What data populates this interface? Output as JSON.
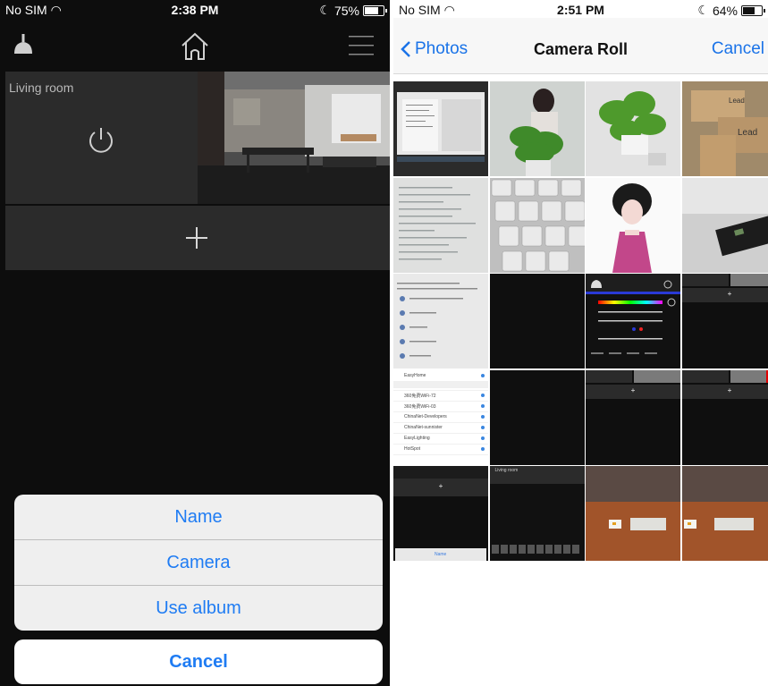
{
  "left_phone": {
    "status": {
      "carrier": "No SIM",
      "time": "2:38 PM",
      "battery": "75%",
      "battery_level": 0.75
    },
    "icons": {
      "lamp": "lamp-icon",
      "home": "home-icon",
      "menu": "menu-icon",
      "power": "power-icon",
      "add": "plus-icon"
    },
    "room": {
      "name": "Living room"
    },
    "action_sheet": {
      "options": [
        "Name",
        "Camera",
        "Use album"
      ],
      "cancel": "Cancel"
    },
    "colors": {
      "accent": "#1f7cf3",
      "tile": "#2b2b2b",
      "background": "#0d0d0d"
    }
  },
  "right_phone": {
    "status": {
      "carrier": "No SIM",
      "time": "2:51 PM",
      "battery": "64%",
      "battery_level": 0.64
    },
    "nav": {
      "back_label": "Photos",
      "title": "Camera Roll",
      "cancel_label": "Cancel"
    },
    "thumbnails": [
      {
        "type": "screenshot-code"
      },
      {
        "type": "plant-person"
      },
      {
        "type": "plant"
      },
      {
        "type": "boxes",
        "box_text": "Lead"
      },
      {
        "type": "code-paper"
      },
      {
        "type": "keyboard"
      },
      {
        "type": "illustration"
      },
      {
        "type": "device"
      },
      {
        "type": "settings-list"
      },
      {
        "type": "black"
      },
      {
        "type": "color-app"
      },
      {
        "type": "app-dark"
      },
      {
        "type": "wifi-list",
        "items": [
          "EasyHome",
          "360免费WiFi-72",
          "360免费WiFi-03",
          "ChinaNet-Developers",
          "ChinaNet-sunnister",
          "EasyLighting",
          "HotSpot"
        ]
      },
      {
        "type": "black"
      },
      {
        "type": "app-dark"
      },
      {
        "type": "app-dark-red"
      },
      {
        "type": "app-name",
        "label": "Name"
      },
      {
        "type": "keyboard-dark",
        "label": "Living room"
      },
      {
        "type": "desk-device"
      },
      {
        "type": "desk-device"
      }
    ],
    "colors": {
      "accent": "#1a73e8",
      "nav_bg": "#f7f7f7"
    }
  }
}
